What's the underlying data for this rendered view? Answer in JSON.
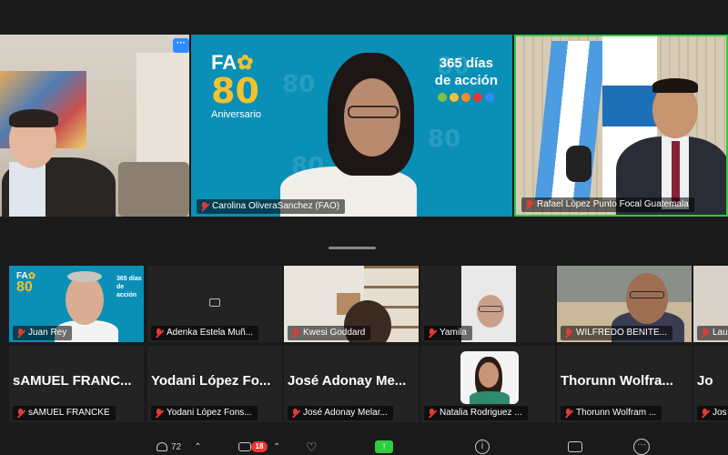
{
  "speakers": [
    {
      "name": "",
      "muted": true
    },
    {
      "name": "Carolina OliveraSanchez (FAO)",
      "muted": true
    },
    {
      "name": "Rafael López Punto Focal Guatemala",
      "muted": true
    }
  ],
  "fao_logo": {
    "letters": "FA",
    "number": "80",
    "caption": "Aniversario"
  },
  "campaign": {
    "line1": "365 días",
    "line2": "de acción",
    "dot_colors": [
      "#7cc242",
      "#f2c230",
      "#f28c28",
      "#e53935",
      "#2d8cff"
    ]
  },
  "more_button": {
    "label": "···"
  },
  "gallery_row1": [
    {
      "name": "Juan Rey"
    },
    {
      "name": "Adenka Estela Muñ..."
    },
    {
      "name": "Kwesi Goddard"
    },
    {
      "name": "Yamila"
    },
    {
      "name": "WILFREDO BENITE..."
    },
    {
      "name": "Lau"
    }
  ],
  "gallery_row2": [
    {
      "title": "sAMUEL FRANC...",
      "name": "sAMUEL FRANCKE"
    },
    {
      "title": "Yodani López Fo...",
      "name": "Yodani López Fons..."
    },
    {
      "title": "José Adonay Me...",
      "name": "José Adonay Melar..."
    },
    {
      "title": "",
      "name": "Natalia Rodriguez ..."
    },
    {
      "title": "Thorunn Wolfra...",
      "name": "Thorunn Wolfram ..."
    },
    {
      "title": "Jo",
      "name": "Jos"
    }
  ],
  "toolbar": {
    "participants_count": "72",
    "chat_badge": "18"
  },
  "colors": {
    "active_border": "#2ecc40",
    "fao_blue": "#0a8fb7",
    "muted_red": "#e53935",
    "share_green": "#2ecc40"
  }
}
